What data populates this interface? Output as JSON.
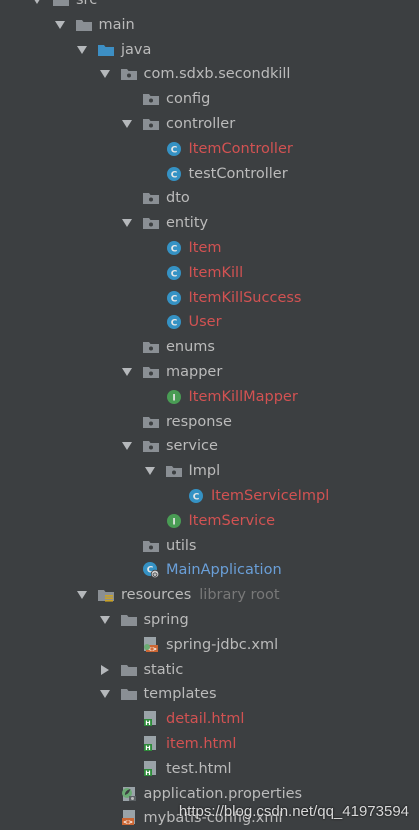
{
  "tree": [
    {
      "label": "src",
      "depth": 0,
      "arrow": "down",
      "icon": "folder",
      "color": "norm"
    },
    {
      "label": "main",
      "depth": 1,
      "arrow": "down",
      "icon": "folder",
      "color": "norm"
    },
    {
      "label": "java",
      "depth": 2,
      "arrow": "down",
      "icon": "source-folder",
      "color": "norm"
    },
    {
      "label": "com.sdxb.secondkill",
      "depth": 3,
      "arrow": "down",
      "icon": "package",
      "color": "norm"
    },
    {
      "label": "config",
      "depth": 4,
      "arrow": "none",
      "icon": "package",
      "color": "norm"
    },
    {
      "label": "controller",
      "depth": 4,
      "arrow": "down",
      "icon": "package",
      "color": "norm"
    },
    {
      "label": "ItemController",
      "depth": 5,
      "arrow": "none",
      "icon": "class",
      "color": "red"
    },
    {
      "label": "testController",
      "depth": 5,
      "arrow": "none",
      "icon": "class",
      "color": "norm"
    },
    {
      "label": "dto",
      "depth": 4,
      "arrow": "none",
      "icon": "package",
      "color": "norm"
    },
    {
      "label": "entity",
      "depth": 4,
      "arrow": "down",
      "icon": "package",
      "color": "norm"
    },
    {
      "label": "Item",
      "depth": 5,
      "arrow": "none",
      "icon": "class",
      "color": "red"
    },
    {
      "label": "ItemKill",
      "depth": 5,
      "arrow": "none",
      "icon": "class",
      "color": "red"
    },
    {
      "label": "ItemKillSuccess",
      "depth": 5,
      "arrow": "none",
      "icon": "class",
      "color": "red"
    },
    {
      "label": "User",
      "depth": 5,
      "arrow": "none",
      "icon": "class",
      "color": "red"
    },
    {
      "label": "enums",
      "depth": 4,
      "arrow": "none",
      "icon": "package",
      "color": "norm"
    },
    {
      "label": "mapper",
      "depth": 4,
      "arrow": "down",
      "icon": "package",
      "color": "norm"
    },
    {
      "label": "ItemKillMapper",
      "depth": 5,
      "arrow": "none",
      "icon": "interface",
      "color": "red"
    },
    {
      "label": "response",
      "depth": 4,
      "arrow": "none",
      "icon": "package",
      "color": "norm"
    },
    {
      "label": "service",
      "depth": 4,
      "arrow": "down",
      "icon": "package",
      "color": "norm"
    },
    {
      "label": "Impl",
      "depth": 5,
      "arrow": "down",
      "icon": "package",
      "color": "norm"
    },
    {
      "label": "ItemServiceImpl",
      "depth": 6,
      "arrow": "none",
      "icon": "class",
      "color": "red"
    },
    {
      "label": "ItemService",
      "depth": 5,
      "arrow": "none",
      "icon": "interface",
      "color": "red"
    },
    {
      "label": "utils",
      "depth": 4,
      "arrow": "none",
      "icon": "package",
      "color": "norm"
    },
    {
      "label": "MainApplication",
      "depth": 4,
      "arrow": "none",
      "icon": "spring-class",
      "color": "blue"
    },
    {
      "label": "resources",
      "depth": 2,
      "arrow": "down",
      "icon": "resources-folder",
      "color": "norm",
      "suffix": "library root"
    },
    {
      "label": "spring",
      "depth": 3,
      "arrow": "down",
      "icon": "folder",
      "color": "norm"
    },
    {
      "label": "spring-jdbc.xml",
      "depth": 4,
      "arrow": "none",
      "icon": "spring-xml",
      "color": "norm"
    },
    {
      "label": "static",
      "depth": 3,
      "arrow": "right",
      "icon": "folder",
      "color": "norm"
    },
    {
      "label": "templates",
      "depth": 3,
      "arrow": "down",
      "icon": "folder",
      "color": "norm"
    },
    {
      "label": "detail.html",
      "depth": 4,
      "arrow": "none",
      "icon": "html",
      "color": "red"
    },
    {
      "label": "item.html",
      "depth": 4,
      "arrow": "none",
      "icon": "html",
      "color": "red"
    },
    {
      "label": "test.html",
      "depth": 4,
      "arrow": "none",
      "icon": "html",
      "color": "norm"
    },
    {
      "label": "application.properties",
      "depth": 3,
      "arrow": "none",
      "icon": "properties",
      "color": "norm"
    },
    {
      "label": "mybatis-config.xml",
      "depth": 3,
      "arrow": "none",
      "icon": "xml",
      "color": "norm"
    }
  ],
  "watermark": "https://blog.csdn.net/qq_41973594",
  "colors": {
    "background": "#3c3f41",
    "text": "#bbbbbb",
    "modified": "#d25252",
    "spring_blue": "#6a9fd8"
  }
}
